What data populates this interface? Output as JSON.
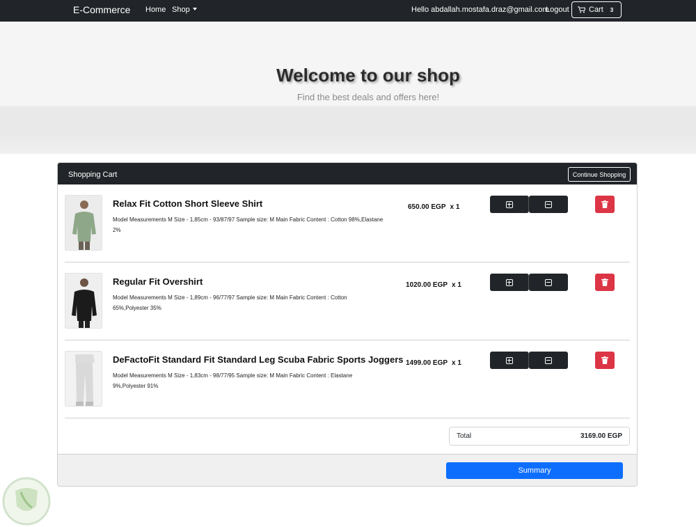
{
  "navbar": {
    "brand": "E-Commerce",
    "home": "Home",
    "shop": "Shop",
    "greeting": "Hello abdallah.mostafa.draz@gmail.com",
    "logout": "Logout",
    "cart_label": "Cart",
    "cart_count": "3"
  },
  "hero": {
    "title": "Welcome to our shop",
    "subtitle": "Find the best deals and offers here!"
  },
  "cart": {
    "title": "Shopping Cart",
    "continue_label": "Continue Shopping",
    "items": [
      {
        "name": "Relax Fit Cotton Short Sleeve Shirt",
        "description": "Model Measurements M Size - 1,85cm - 93/87/97 Sample size: M Main Fabric Content : Cotton 98%,Elastane 2%",
        "price": "650.00 EGP",
        "qty": "x 1"
      },
      {
        "name": "Regular Fit Overshirt",
        "description": "Model Measurements M Size - 1,89cm - 96/77/97 Sample size: M Main Fabric Content : Cotton 65%,Polyester 35%",
        "price": "1020.00 EGP",
        "qty": "x 1"
      },
      {
        "name": "DeFactoFit Standard Fit Standard Leg Scuba Fabric Sports Joggers",
        "description": "Model Measurements M Size - 1,83cm - 98/77/95 Sample size: M Main Fabric Content : Elastane 9%,Polyester 91%",
        "price": "1499.00 EGP",
        "qty": "x 1"
      }
    ],
    "total_label": "Total",
    "total_value": "3169.00 EGP",
    "summary_label": "Summary"
  },
  "icons": {
    "cart": "cart-icon",
    "increase": "plus-square-icon",
    "decrease": "minus-square-icon",
    "delete": "trash-icon"
  },
  "colors": {
    "navbar": "#212529",
    "primary": "#0d6efd",
    "danger": "#dc3545"
  }
}
